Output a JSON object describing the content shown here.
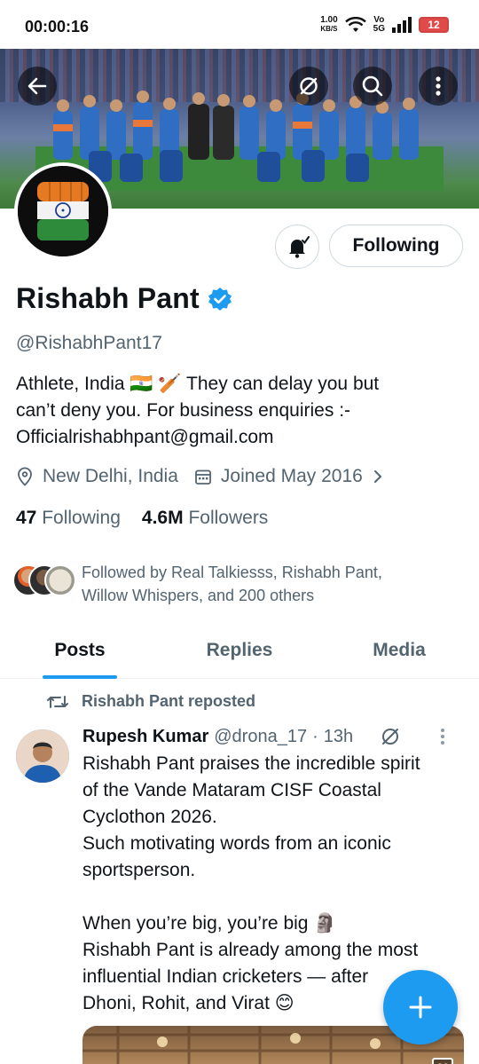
{
  "status_bar": {
    "time": "00:00:16",
    "speed_value": "1.00",
    "speed_unit": "KB/S",
    "network_label_top": "Vo",
    "network_label_bottom": "5G",
    "battery": "12"
  },
  "header": {
    "back_icon": "back-arrow-icon",
    "grok_icon": "grok-icon",
    "search_icon": "search-icon",
    "more_icon": "more-vertical-icon"
  },
  "profile": {
    "name": "Rishabh Pant",
    "verified": true,
    "handle": "@RishabhPant17",
    "bio_line1": "Athlete, India 🇮🇳 🏏 They can delay you but",
    "bio_line2": "can’t deny you. For business enquiries :-",
    "bio_line3": "Officialrishabhpant@gmail.com",
    "location": "New Delhi, India",
    "joined": "Joined May 2016",
    "following_count": "47",
    "following_label": "Following",
    "followers_count": "4.6M",
    "followers_label": "Followers",
    "followed_by_line1": "Followed by Real Talkiesss, Rishabh Pant,",
    "followed_by_line2": "Willow Whispers, and 200 others",
    "follow_button": "Following"
  },
  "tabs": [
    {
      "label": "Posts",
      "active": true
    },
    {
      "label": "Replies",
      "active": false
    },
    {
      "label": "Media",
      "active": false
    }
  ],
  "post": {
    "repost_label": "Rishabh Pant reposted",
    "author_name": "Rupesh Kumar",
    "author_handle": "@drona_17",
    "separator": "·",
    "time": "13h",
    "text_lines": [
      "Rishabh Pant praises the incredible spirit",
      "of the Vande Mataram CISF Coastal",
      "Cyclothon 2026.",
      "Such motivating words from an iconic",
      "sportsperson.",
      "",
      "When you’re big, you’re big 🗿",
      "Rishabh Pant is already among the most",
      "influential Indian cricketers — after",
      "Dhoni, Rohit, and Virat 😊"
    ],
    "media_badge": "CC"
  },
  "colors": {
    "accent": "#1d9bf0",
    "text_primary": "#0f1419",
    "text_secondary": "#536471",
    "border": "#cfd9de"
  }
}
